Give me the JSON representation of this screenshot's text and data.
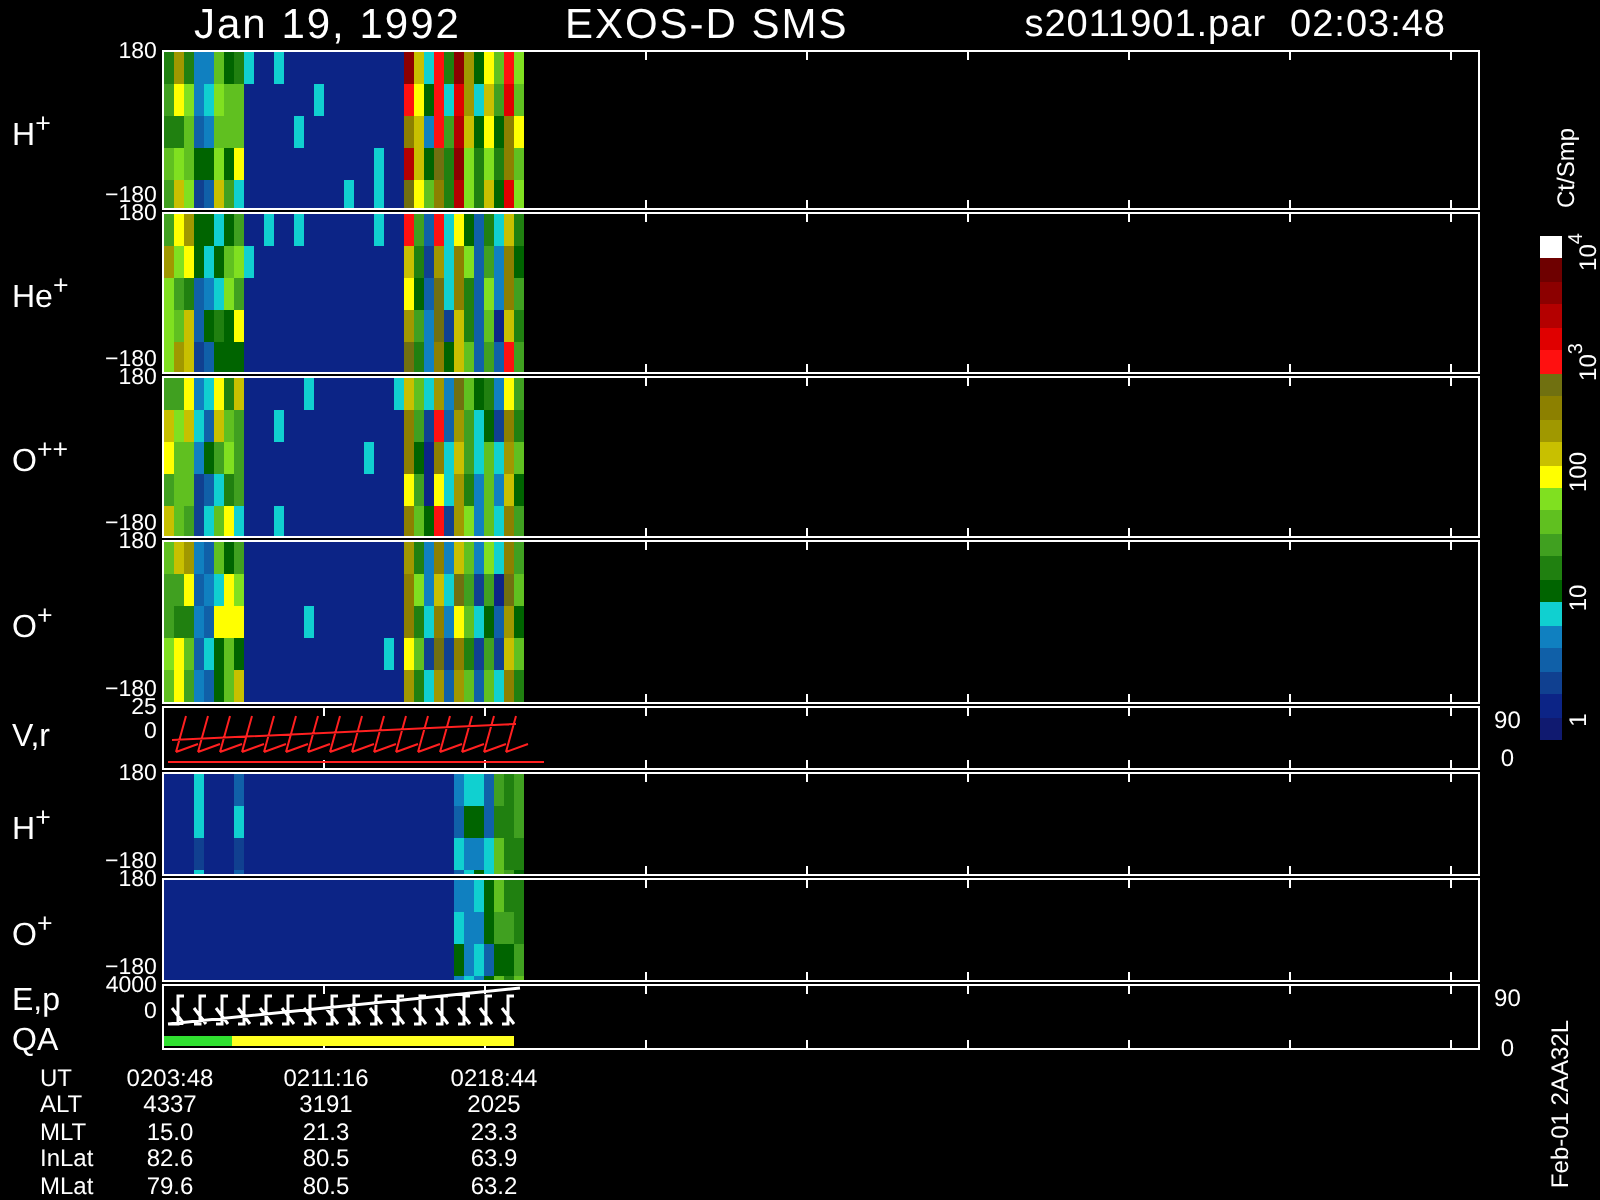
{
  "header": {
    "date": "Jan 19, 1992",
    "instrument": "EXOS-D SMS",
    "file": "s2011901.par",
    "time": "02:03:48"
  },
  "panels": [
    {
      "kind": "spectrogram",
      "label": "H$^{+}$",
      "ticks": [
        "180",
        "−180"
      ]
    },
    {
      "kind": "spectrogram",
      "label": "He$^{+}$",
      "ticks": [
        "180",
        "−180"
      ]
    },
    {
      "kind": "spectrogram",
      "label": "O$^{++}$",
      "ticks": [
        "180",
        "−180"
      ]
    },
    {
      "kind": "spectrogram",
      "label": "O$^{+}$",
      "ticks": [
        "180",
        "−180"
      ]
    },
    {
      "kind": "velocity",
      "label": "V,r",
      "ticks": [
        "25",
        "0"
      ],
      "right_ticks": [
        "90",
        "0"
      ]
    },
    {
      "kind": "spectrogram",
      "label": "H$^{+}$",
      "ticks": [
        "180",
        "−180"
      ]
    },
    {
      "kind": "spectrogram",
      "label": "O$^{+}$",
      "ticks": [
        "180",
        "−180"
      ]
    },
    {
      "kind": "energy",
      "label": "E,p",
      "label_2": "QA",
      "ticks": [
        "4000",
        "0"
      ],
      "right_ticks": [
        "90",
        "0"
      ]
    }
  ],
  "colorbar": {
    "unit": "Ct/Smp",
    "ticks": [
      "10$^{4}$",
      "10$^{3}$",
      "100",
      "10",
      "1"
    ]
  },
  "ephemeris": [
    {
      "name": "UT",
      "values": [
        "0203:48",
        "0211:16",
        "0218:44"
      ]
    },
    {
      "name": "ALT",
      "values": [
        "4337",
        "3191",
        "2025"
      ]
    },
    {
      "name": "MLT",
      "values": [
        "15.0",
        "21.3",
        "23.3"
      ]
    },
    {
      "name": "InLat",
      "values": [
        "82.6",
        "80.5",
        "63.9"
      ]
    },
    {
      "name": "MLat",
      "values": [
        "79.6",
        "80.5",
        "63.2"
      ]
    }
  ],
  "plot_id": "Feb-01 2AA32L"
}
